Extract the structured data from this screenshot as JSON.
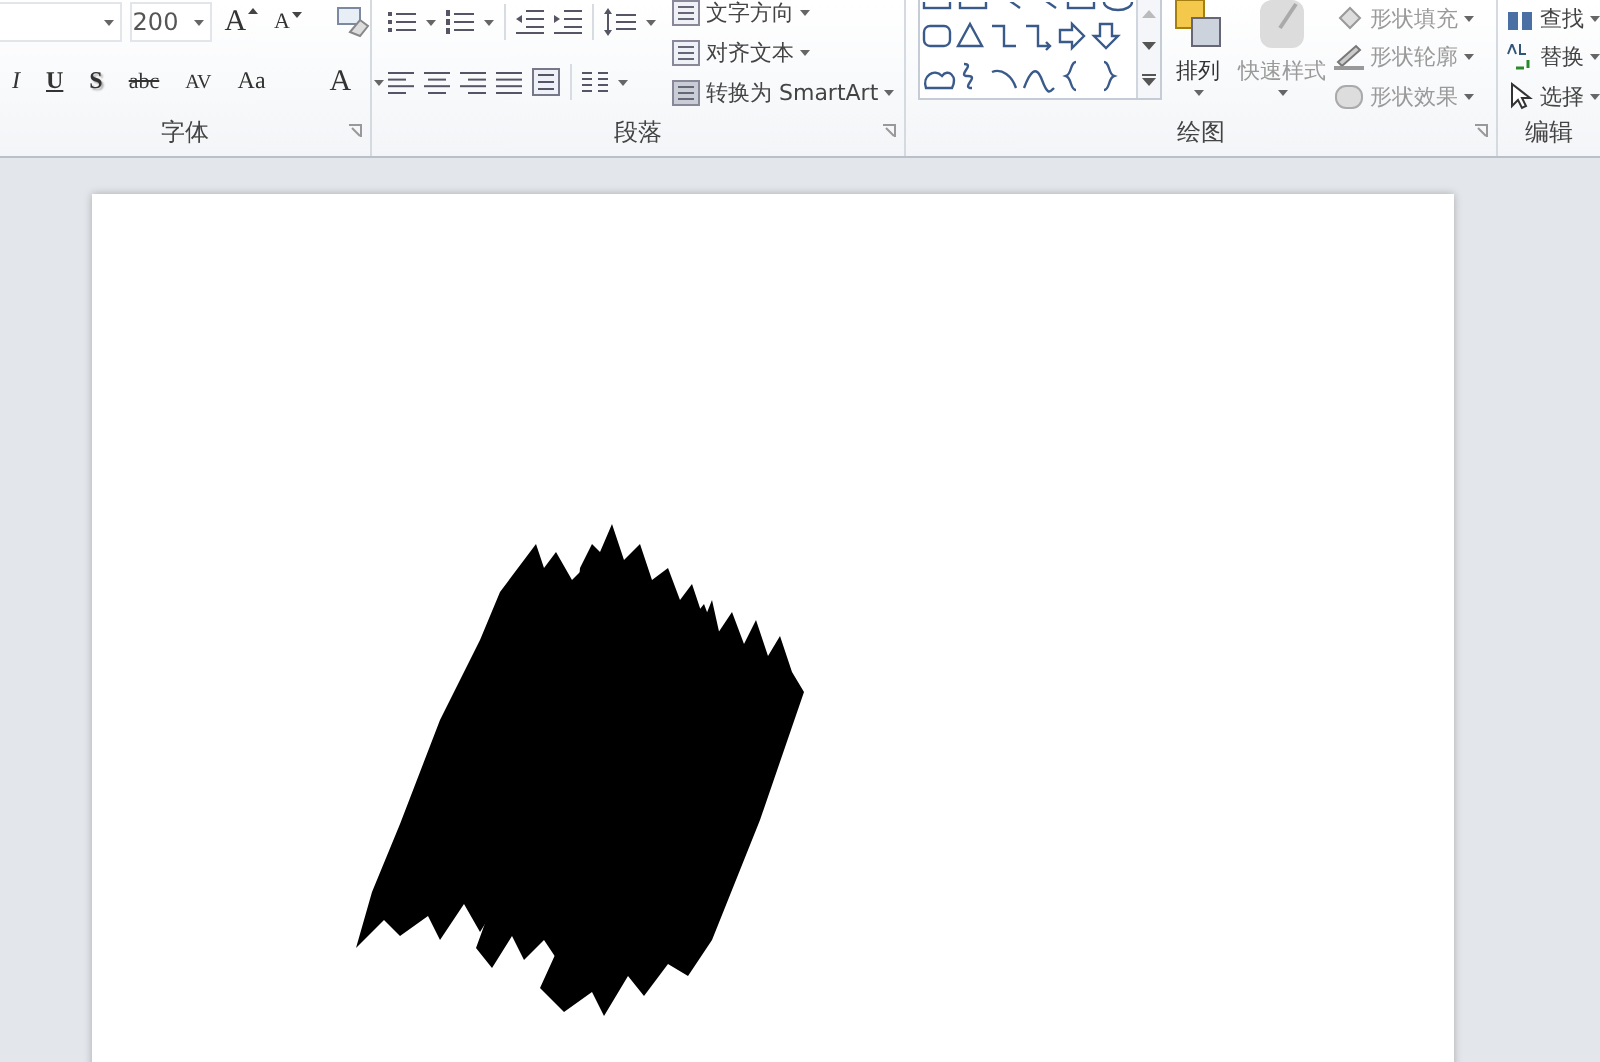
{
  "font_group": {
    "size": "200",
    "grow_font": "A",
    "shrink_font": "A",
    "format_buttons": [
      {
        "label": "I",
        "kind": "italic"
      },
      {
        "label": "U",
        "kind": "underline"
      },
      {
        "label": "S",
        "kind": "shadow"
      },
      {
        "label": "abc",
        "kind": "strike"
      },
      {
        "label": "AV",
        "kind": "spacing"
      },
      {
        "label": "Aa",
        "kind": "case"
      }
    ],
    "font_color": "A",
    "label": "字体"
  },
  "paragraph_group": {
    "commands": [
      {
        "label": "文字方向"
      },
      {
        "label": "对齐文本"
      },
      {
        "label": "转换为 SmartArt"
      }
    ],
    "label": "段落"
  },
  "drawing_group": {
    "arrange": "排列",
    "quick_styles": {
      "label": "快速样式",
      "disabled": true
    },
    "shape_commands": [
      {
        "label": "形状填充",
        "disabled": true
      },
      {
        "label": "形状轮廓",
        "disabled": true
      },
      {
        "label": "形状效果",
        "disabled": true
      }
    ],
    "label": "绘图"
  },
  "editing_group": {
    "commands": [
      {
        "label": "查找"
      },
      {
        "label": "替换"
      },
      {
        "label": "选择"
      }
    ],
    "label": "编辑"
  }
}
